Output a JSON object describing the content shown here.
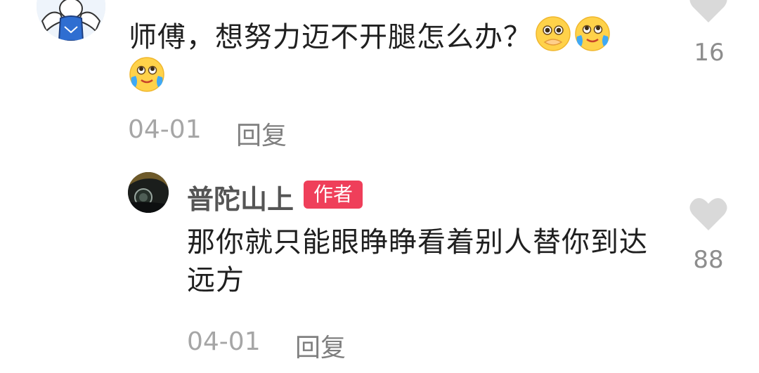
{
  "comment": {
    "text": "师傅，想努力迈不开腿怎么办？",
    "emojis": [
      "pleading-face-icon",
      "crying-laugh-icon",
      "crying-laugh-icon"
    ],
    "date": "04-01",
    "reply_label": "回复",
    "like_count": "16"
  },
  "reply": {
    "author": "普陀山上",
    "badge": "作者",
    "text": "那你就只能眼睁睁看着别人替你到达远方",
    "date": "04-01",
    "reply_label": "回复",
    "like_count": "88"
  },
  "colors": {
    "badge_bg": "#ef3f5a",
    "text": "#1f1f1f",
    "muted": "#a6a6a6",
    "heart": "#d9d9d9"
  }
}
